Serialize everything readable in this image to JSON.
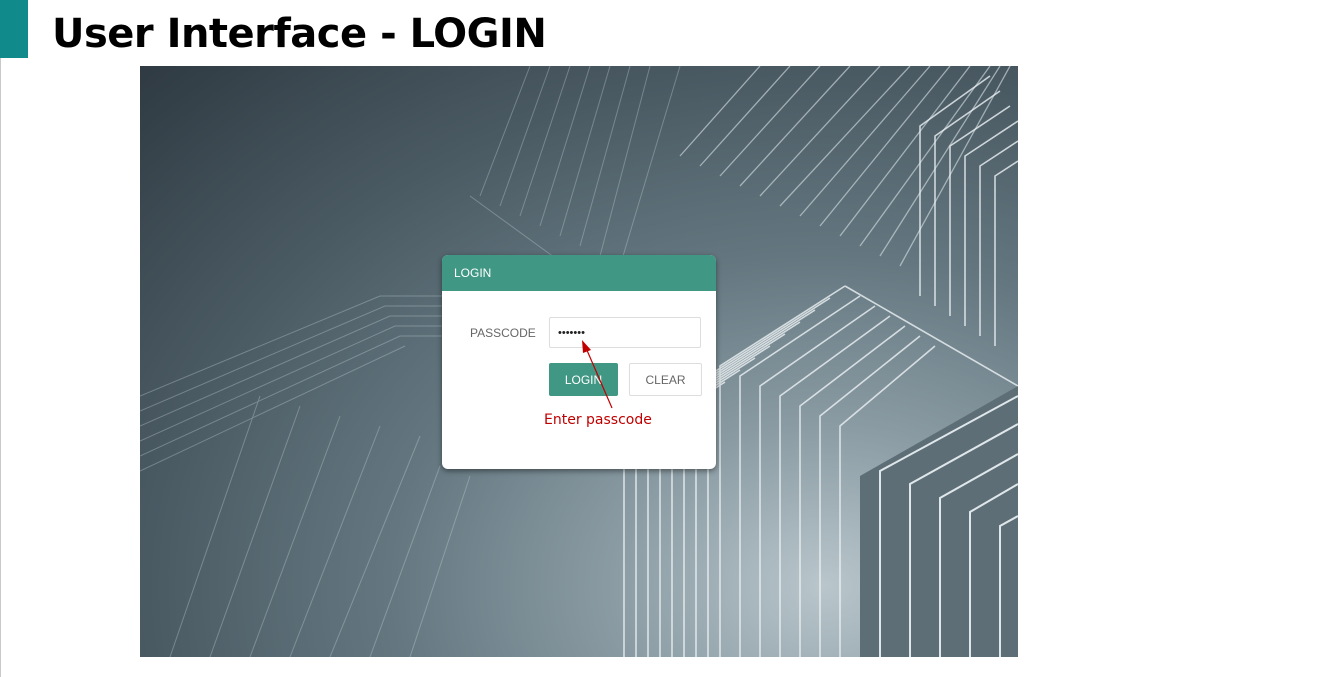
{
  "slide": {
    "title": "User Interface - LOGIN",
    "accent_color": "#108a8a"
  },
  "login_dialog": {
    "header": "LOGIN",
    "passcode_label": "PASSCODE",
    "passcode_value": "•••••••",
    "login_button": "LOGIN",
    "clear_button": "CLEAR",
    "accent_color": "#3f9784"
  },
  "annotation": {
    "text": "Enter passcode",
    "color": "#c00000",
    "arrow_icon": "arrow-up-left-icon"
  }
}
